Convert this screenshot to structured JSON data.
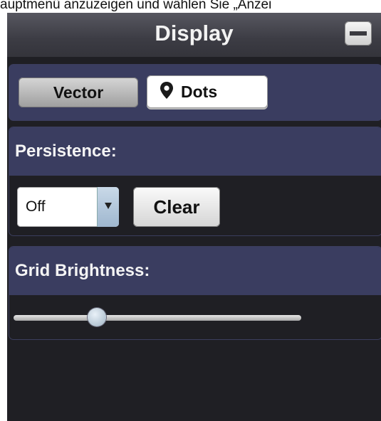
{
  "caption": "auptmenü anzuzeigen und wählen Sie „Anzei",
  "window": {
    "title": "Display"
  },
  "display_mode": {
    "options": [
      "Vector",
      "Dots"
    ],
    "selected": "Dots",
    "selected_icon": "location-pin-icon"
  },
  "persistence": {
    "label": "Persistence:",
    "select_value": "Off",
    "clear_label": "Clear"
  },
  "grid_brightness": {
    "label": "Grid Brightness:",
    "value_fraction": 0.29
  },
  "colors": {
    "panel_bg": "#1f1f24",
    "section_header_bg": "#3a3d60",
    "title_text": "#f2f2f2"
  }
}
